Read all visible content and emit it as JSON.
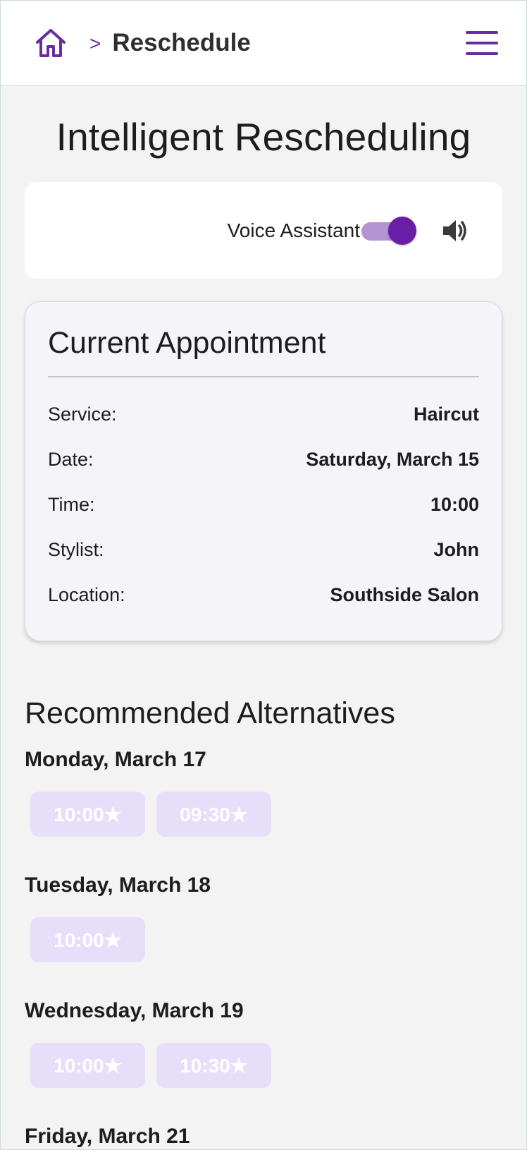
{
  "header": {
    "home_icon": "home-icon",
    "separator": ">",
    "current": "Reschedule",
    "menu_icon": "hamburger-menu-icon"
  },
  "title": "Intelligent Rescheduling",
  "voice": {
    "label": "Voice Assistant",
    "enabled": true,
    "speaker_icon": "speaker-icon"
  },
  "appointment": {
    "title": "Current Appointment",
    "rows": [
      {
        "label": "Service:",
        "value": "Haircut"
      },
      {
        "label": "Date:",
        "value": "Saturday, March 15"
      },
      {
        "label": "Time:",
        "value": "10:00"
      },
      {
        "label": "Stylist:",
        "value": "John"
      },
      {
        "label": "Location:",
        "value": "Southside Salon"
      }
    ]
  },
  "alternatives": {
    "heading": "Recommended Alternatives",
    "days": [
      {
        "day": "Monday, March 17",
        "slots": [
          "10:00★",
          "09:30★"
        ]
      },
      {
        "day": "Tuesday, March 18",
        "slots": [
          "10:00★"
        ]
      },
      {
        "day": "Wednesday, March 19",
        "slots": [
          "10:00★",
          "10:30★"
        ]
      },
      {
        "day": "Friday, March 21",
        "slots": []
      }
    ]
  },
  "colors": {
    "accent": "#6a1ea6",
    "toggle_track": "#b393d2",
    "slot_bg": "#e7defa",
    "page_bg": "#f3f3f4"
  }
}
